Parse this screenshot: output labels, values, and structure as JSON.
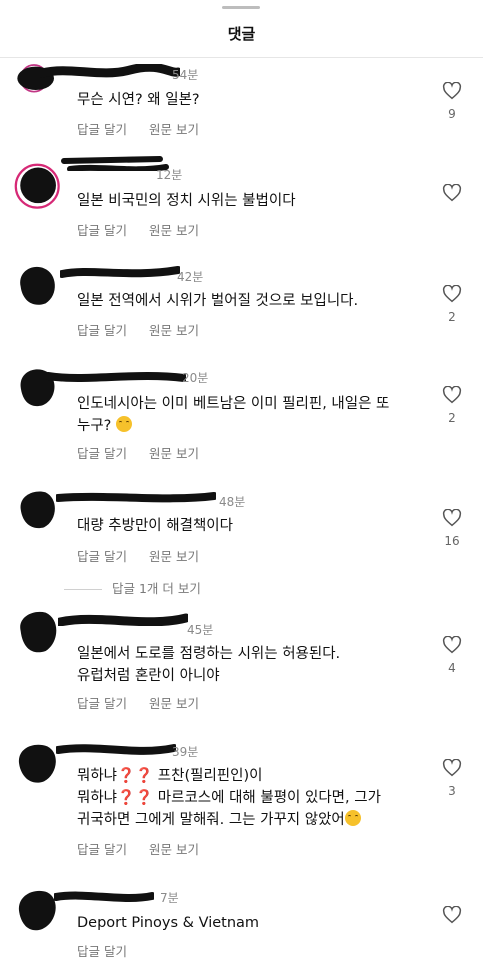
{
  "header": {
    "title": "댓글"
  },
  "icons": {
    "like": "heart-outline-icon",
    "emoji_laugh": "grinning-sweat-emoji",
    "emoji_tired": "weary-face-emoji",
    "question": "red-question-mark-emoji"
  },
  "colors": {
    "question_mark": "#d62b2b",
    "emoji": "#f6c12b"
  },
  "comments": [
    {
      "time": "54분",
      "text": "무슨 시연? 왜 일본?",
      "reply": "답글 달기",
      "translate": "원문 보기",
      "likes": "9"
    },
    {
      "time": "12분",
      "text": "일본 비국민의 정치 시위는 불법이다",
      "reply": "답글 달기",
      "translate": "원문 보기",
      "likes": ""
    },
    {
      "time": "42분",
      "text": "일본 전역에서 시위가 벌어질 것으로 보입니다.",
      "reply": "답글 달기",
      "translate": "원문 보기",
      "likes": "2"
    },
    {
      "time": "20분",
      "text": "인도네시아는 이미 베트남은 이미 필리핀, 내일은 또",
      "text2": "누구?",
      "reply": "답글 달기",
      "translate": "원문 보기",
      "likes": "2"
    },
    {
      "time": "48분",
      "text": "대량 추방만이 해결책이다",
      "reply": "답글 달기",
      "translate": "원문 보기",
      "likes": "16"
    },
    {
      "time": "45분",
      "text": "일본에서 도로를 점령하는 시위는 허용된다.",
      "text2": "유럽처럼 혼란이 아니야",
      "reply": "답글 달기",
      "translate": "원문 보기",
      "likes": "4"
    },
    {
      "time": "39분",
      "line1a": "뭐하냐",
      "line1b": "프찬(필리핀인)이",
      "line2a": "뭐하냐",
      "line2b": "마르코스에 대해 불평이 있다면, 그가",
      "line3": "귀국하면 그에게 말해줘. 그는 가꾸지 않았어",
      "q": "❓",
      "reply": "답글 달기",
      "translate": "원문 보기",
      "likes": "3"
    },
    {
      "time": "7분",
      "text": "Deport Pinoys & Vietnam",
      "reply": "답글 달기",
      "likes": ""
    }
  ],
  "more_replies": "답글 1개 더 보기"
}
